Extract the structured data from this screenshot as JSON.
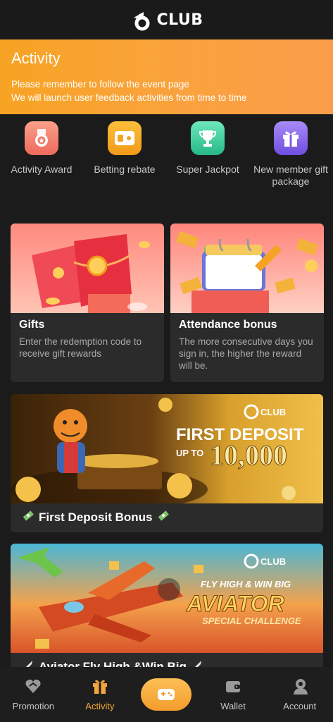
{
  "header": {
    "logo_text": "CLUB"
  },
  "banner": {
    "title": "Activity",
    "line1": "Please remember to follow the event page",
    "line2": "We will launch user feedback activities from time to time"
  },
  "quick_links": [
    {
      "label": "Activity Award",
      "icon": "award-medal-icon",
      "color": "#f07a6a"
    },
    {
      "label": "Betting rebate",
      "icon": "rebate-card-icon",
      "color": "#f5a22a"
    },
    {
      "label": "Super Jackpot",
      "icon": "trophy-icon",
      "color": "#3fcf9b"
    },
    {
      "label": "New member gift package",
      "icon": "gift-box-icon",
      "color": "#8e6cf0"
    }
  ],
  "cards": [
    {
      "title": "Gifts",
      "description": "Enter the redemption code to receive gift rewards"
    },
    {
      "title": "Attendance bonus",
      "description": "The more consecutive days you sign in, the higher the reward will be."
    }
  ],
  "promos": [
    {
      "title": "First Deposit Bonus",
      "art_brand": "CLUB",
      "art_line1": "FIRST DEPOSIT",
      "art_line2": "UP TO",
      "art_amount": "10,000"
    },
    {
      "title": "Aviator Fly High &Win Big",
      "art_brand": "CLUB",
      "art_line1": "FLY HIGH & WIN BIG",
      "art_line2": "AVIATOR",
      "art_line3": "SPECIAL CHALLENGE"
    }
  ],
  "tabbar": {
    "items": [
      {
        "label": "Promotion",
        "icon": "promotion-icon"
      },
      {
        "label": "Activity",
        "icon": "activity-gift-icon",
        "active": true
      },
      {
        "label": "",
        "icon": "game-controller-icon"
      },
      {
        "label": "Wallet",
        "icon": "wallet-icon"
      },
      {
        "label": "Account",
        "icon": "account-icon"
      }
    ]
  },
  "colors": {
    "accent": "#f5a53a",
    "background": "#1b1b1b",
    "card": "#2b2b2b"
  }
}
